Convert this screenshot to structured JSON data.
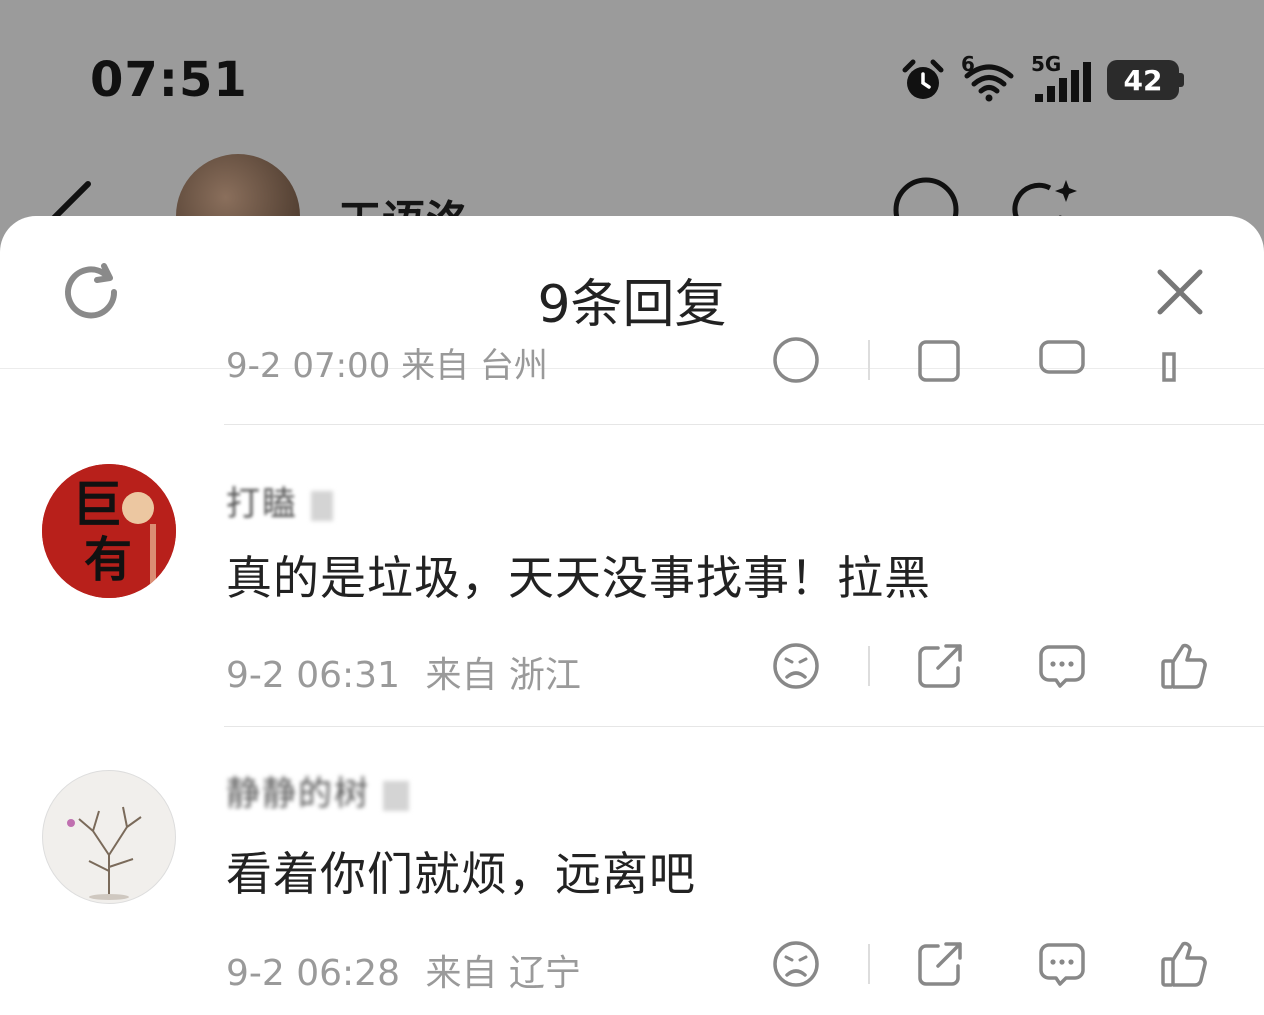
{
  "status_bar": {
    "time": "07:51",
    "wifi_label": "6",
    "network": "5G",
    "battery": "42",
    "icons": [
      "alarm-icon",
      "wifi-icon",
      "signal-icon",
      "battery-icon"
    ]
  },
  "behind": {
    "title": "天语洛-"
  },
  "sheet": {
    "title": "9条回复"
  },
  "partial_comment": {
    "meta": "9-2 07:00 来自 台州"
  },
  "comments": [
    {
      "username": "打瞌",
      "text": "真的是垃圾，天天没事找事！拉黑",
      "time": "9-2 06:31",
      "source": "来自 浙江",
      "avatar_text": "巨有钱"
    },
    {
      "username": "静静的树",
      "text": "看着你们就烦，远离吧",
      "time": "9-2 06:28",
      "source": "来自 辽宁"
    }
  ],
  "colors": {
    "overlay": "#9b9b9b",
    "text": "#222222",
    "meta": "#9a9a9a",
    "icon": "#777777"
  }
}
